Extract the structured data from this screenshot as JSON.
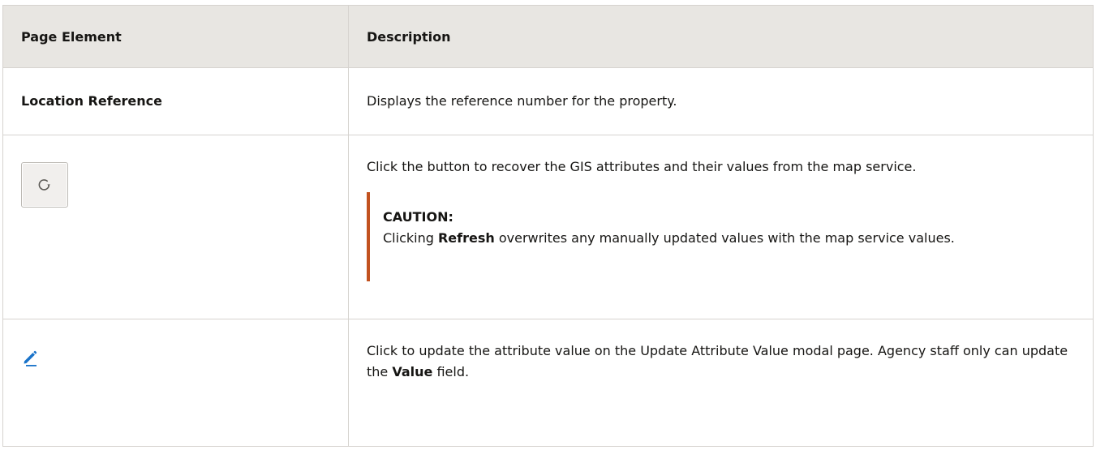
{
  "table": {
    "headers": {
      "element": "Page Element",
      "description": "Description"
    },
    "rows": {
      "location": {
        "element": "Location Reference",
        "description": "Displays the reference number for the property."
      },
      "refresh": {
        "element_icon": "refresh-icon",
        "description": "Click the button to recover the GIS attributes and their values from the map service.",
        "caution_title": "CAUTION:",
        "caution_text_before": "Clicking ",
        "caution_bold": "Refresh",
        "caution_text_after": " overwrites any manually updated values with the map service values."
      },
      "edit": {
        "element_icon": "pencil-icon",
        "description_before": "Click to update the attribute value on the Update Attribute Value modal page. Agency staff only can update the ",
        "description_bold": "Value",
        "description_after": " field."
      }
    }
  },
  "colors": {
    "header_bg": "#e8e6e2",
    "border": "#d6d3cf",
    "caution_bar": "#c2521f",
    "pencil": "#1a73c9"
  }
}
